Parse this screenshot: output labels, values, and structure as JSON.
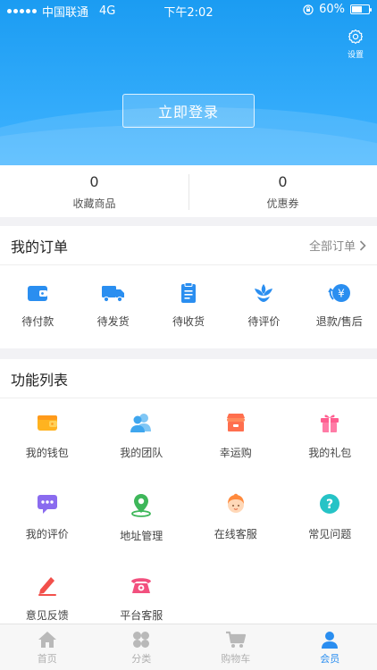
{
  "status_bar": {
    "carrier": "中国联通",
    "network": "4G",
    "time": "下午2:02",
    "battery_percent": "60%",
    "battery_level": 0.6
  },
  "header": {
    "settings_label": "设置",
    "login_label": "立即登录",
    "accent_color": "#1b9cf2"
  },
  "stats": [
    {
      "value": "0",
      "label": "收藏商品"
    },
    {
      "value": "0",
      "label": "优惠券"
    }
  ],
  "orders": {
    "title": "我的订单",
    "more_label": "全部订单",
    "items": [
      {
        "label": "待付款",
        "icon": "wallet-icon"
      },
      {
        "label": "待发货",
        "icon": "truck-icon"
      },
      {
        "label": "待收货",
        "icon": "clipboard-icon"
      },
      {
        "label": "待评价",
        "icon": "flower-icon"
      },
      {
        "label": "退款/售后",
        "icon": "refund-icon"
      }
    ]
  },
  "functions": {
    "title": "功能列表",
    "items": [
      {
        "label": "我的钱包",
        "icon": "wallet-icon"
      },
      {
        "label": "我的团队",
        "icon": "team-icon"
      },
      {
        "label": "幸运购",
        "icon": "shop-icon"
      },
      {
        "label": "我的礼包",
        "icon": "gift-icon"
      },
      {
        "label": "我的评价",
        "icon": "chat-icon"
      },
      {
        "label": "地址管理",
        "icon": "location-icon"
      },
      {
        "label": "在线客服",
        "icon": "service-icon"
      },
      {
        "label": "常见问题",
        "icon": "help-icon"
      },
      {
        "label": "意见反馈",
        "icon": "pen-icon"
      },
      {
        "label": "平台客服",
        "icon": "phone-icon"
      }
    ]
  },
  "tabbar": [
    {
      "label": "首页",
      "icon": "home-icon",
      "active": false
    },
    {
      "label": "分类",
      "icon": "category-icon",
      "active": false
    },
    {
      "label": "购物车",
      "icon": "cart-icon",
      "active": false
    },
    {
      "label": "会员",
      "icon": "member-icon",
      "active": true
    }
  ]
}
